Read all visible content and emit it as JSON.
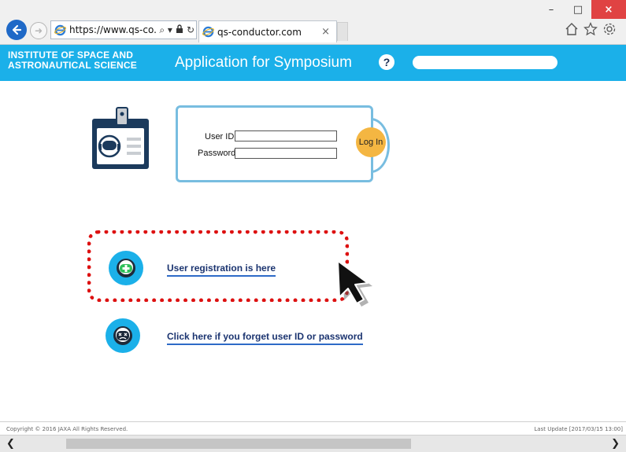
{
  "browser": {
    "address_url": "https://www.qs-co...",
    "tab_title": "qs-conductor.com",
    "tab_close": "×",
    "minimize": "–",
    "maximize": "□",
    "close": "×",
    "search_tool": "⌕ ▾",
    "lock": "🔒",
    "refresh": "↻"
  },
  "header": {
    "institute_line1": "INSTITUTE OF SPACE AND",
    "institute_line2": "ASTRONAUTICAL SCIENCE",
    "app_title": "Application for Symposium",
    "help_label": "?"
  },
  "login": {
    "user_id_label": "User ID",
    "password_label": "Password",
    "button_label": "Log In"
  },
  "links": {
    "register": "User registration is here",
    "forgot": "Click here if you forget user ID or password"
  },
  "footer": {
    "copyright": "Copyright © 2016 JAXA All Rights Reserved.",
    "last_update": "Last Update [2017/03/15 13:00]"
  },
  "scrollbar": {
    "left_arrow": "❮",
    "right_arrow": "❯"
  },
  "colors": {
    "accent": "#1bb0e9",
    "highlight": "#dd1111",
    "login_button": "#f4b642",
    "card_border": "#78bde0"
  }
}
